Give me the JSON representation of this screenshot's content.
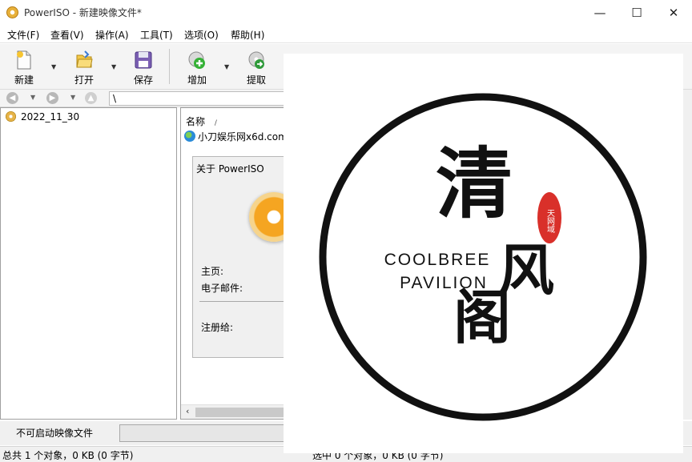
{
  "window": {
    "title": "PowerISO - 新建映像文件*",
    "minimize_glyph": "—",
    "maximize_glyph": "☐",
    "close_glyph": "✕"
  },
  "menu": [
    "文件(F)",
    "查看(V)",
    "操作(A)",
    "工具(T)",
    "选项(O)",
    "帮助(H)"
  ],
  "toolbar": {
    "new_label": "新建",
    "open_label": "打开",
    "save_label": "保存",
    "add_label": "增加",
    "extract_label": "提取",
    "icons": {
      "new": "new-document-icon",
      "open": "open-folder-icon",
      "save": "floppy-disk-icon",
      "add": "add-plus-icon",
      "extract": "extract-icon"
    }
  },
  "address": {
    "path": "\\"
  },
  "tree": {
    "root_label": "2022_11_30"
  },
  "list": {
    "column_name": "名称",
    "sort_glyph": "/",
    "rows": [
      {
        "name": "小刀娱乐网x6d.com"
      }
    ]
  },
  "about": {
    "title": "关于 PowerISO",
    "homepage_label": "主页:",
    "email_label": "电子邮件:",
    "registered_label": "注册给:"
  },
  "status": {
    "boot_label": "不可启动映像文件",
    "progress_fraction": 0.0,
    "left_text": "总共 1 个对象，0 KB (0 字节)",
    "right_text": "选中 0 个对象，0 KB (0 字节)"
  },
  "overlay_logo": {
    "big_char_top": "清",
    "big_char_mid": "风",
    "big_char_bottom": "阁",
    "seal_text": "天网域",
    "english_line1": "COOLBREE",
    "english_line2": "PAVILION",
    "seal_color": "#d9302a"
  },
  "colors": {
    "progress_green": "#06b025",
    "toolbar_bg": "#f4f4f4"
  }
}
